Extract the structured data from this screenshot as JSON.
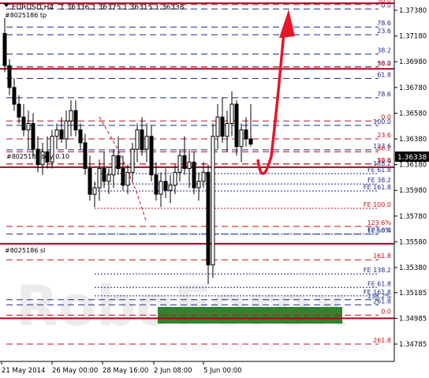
{
  "header": {
    "symbol": "EURUSD,H4",
    "ohlc": "1.36336 1.36375 1.36315 1.36338",
    "label_tp": "#8025186 tp",
    "label_buy": "#8025186 buy 0.10",
    "label_sl": "#8025186 sl"
  },
  "current_price": "1.36338",
  "watermark": "RoboForex",
  "watermark_sub": "ИНТЕРНЕТ-БРОКЕР  ·  ДЛЯ НАЧИНАЮЩИХ  ·  ПРОФЕССИОНАЛОВ",
  "colors": {
    "bull_candle": "#000000",
    "bear_candle": "#000000",
    "trade_line": "#b00020",
    "fibo_blue": "#1a2a8c",
    "fibo_red": "#c0101a",
    "arrow": "#e8142a",
    "target_zone": "#1e7a1e",
    "text": "#000000"
  },
  "chart_data": {
    "type": "candlestick",
    "ylim": [
      1.3465,
      1.3746
    ],
    "y_ticks": [
      "1.37380",
      "1.37180",
      "1.36980",
      "1.36780",
      "1.36580",
      "1.36380",
      "1.36180",
      "1.35980",
      "1.35780",
      "1.35580",
      "1.35380",
      "1.35185",
      "1.34985",
      "1.34785"
    ],
    "x_ticks": [
      "21 May 2014",
      "26 May 00:00",
      "28 May 16:00",
      "2 Jun 08:00",
      "5 Jun 00:00"
    ],
    "trade_levels": [
      {
        "name": "tp",
        "price": 1.37435
      },
      {
        "name": "entry",
        "price": 1.36925
      },
      {
        "name": "buy",
        "price": 1.3616
      },
      {
        "name": "sl",
        "price": 1.35565
      },
      {
        "name": "low",
        "price": 1.34985
      }
    ],
    "fibo_levels": [
      {
        "label": "50.0",
        "price": 1.37425,
        "color": "red"
      },
      {
        "label": "0.0",
        "price": 1.3739,
        "color": "blue"
      },
      {
        "label": "78.6",
        "price": 1.3725,
        "color": "blue"
      },
      {
        "label": "23.6",
        "price": 1.3719,
        "color": "blue"
      },
      {
        "label": "38.2",
        "price": 1.3704,
        "color": "blue"
      },
      {
        "label": "50.0",
        "price": 1.3694,
        "color": "blue"
      },
      {
        "label": "38.2",
        "price": 1.3694,
        "color": "red"
      },
      {
        "label": "61.8",
        "price": 1.3685,
        "color": "blue"
      },
      {
        "label": "78.6",
        "price": 1.367,
        "color": "blue"
      },
      {
        "label": "0.0",
        "price": 1.3652,
        "color": "red"
      },
      {
        "label": "100.0",
        "price": 1.36485,
        "color": "blue"
      },
      {
        "label": "23.6",
        "price": 1.3638,
        "color": "red"
      },
      {
        "label": "123.6",
        "price": 1.36295,
        "color": "blue"
      },
      {
        "label": "38.2",
        "price": 1.3628,
        "color": "red"
      },
      {
        "label": "23.6",
        "price": 1.36185,
        "color": "red"
      },
      {
        "label": "50.0",
        "price": 1.36185,
        "color": "red"
      },
      {
        "label": "138.2",
        "price": 1.3616,
        "color": "blue"
      },
      {
        "label": "FE 61.8",
        "price": 1.3611,
        "color": "blue"
      },
      {
        "label": "FE 38.2",
        "price": 1.3603,
        "color": "blue"
      },
      {
        "label": "FE 161.8",
        "price": 1.35975,
        "color": "blue"
      },
      {
        "label": "FE 100.0",
        "price": 1.3584,
        "color": "red"
      },
      {
        "label": "123.6%",
        "price": 1.357,
        "color": "red"
      },
      {
        "label": "FE 50.0",
        "price": 1.3564,
        "color": "blue"
      },
      {
        "label": "123.6%",
        "price": 1.3564,
        "color": "blue"
      },
      {
        "label": "161.8",
        "price": 1.3544,
        "color": "red"
      },
      {
        "label": "FE 138.2",
        "price": 1.3533,
        "color": "blue"
      },
      {
        "label": "FE 61.8",
        "price": 1.35225,
        "color": "blue"
      },
      {
        "label": "FE 161.8",
        "price": 1.3516,
        "color": "blue"
      },
      {
        "label": "138.2%",
        "price": 1.3513,
        "color": "blue"
      },
      {
        "label": "261.8",
        "price": 1.3509,
        "color": "blue"
      },
      {
        "label": "0.0",
        "price": 1.3501,
        "color": "red"
      },
      {
        "label": "261.8",
        "price": 1.34785,
        "color": "red"
      }
    ],
    "candles": [
      {
        "o": 1.372,
        "h": 1.3732,
        "l": 1.369,
        "c": 1.3695
      },
      {
        "o": 1.3695,
        "h": 1.37,
        "l": 1.3672,
        "c": 1.3678
      },
      {
        "o": 1.3678,
        "h": 1.3685,
        "l": 1.366,
        "c": 1.3665
      },
      {
        "o": 1.3665,
        "h": 1.3672,
        "l": 1.365,
        "c": 1.3655
      },
      {
        "o": 1.3655,
        "h": 1.3665,
        "l": 1.364,
        "c": 1.3645
      },
      {
        "o": 1.3645,
        "h": 1.366,
        "l": 1.363,
        "c": 1.365
      },
      {
        "o": 1.365,
        "h": 1.3658,
        "l": 1.3625,
        "c": 1.363
      },
      {
        "o": 1.363,
        "h": 1.364,
        "l": 1.3612,
        "c": 1.3618
      },
      {
        "o": 1.3618,
        "h": 1.3635,
        "l": 1.361,
        "c": 1.3628
      },
      {
        "o": 1.3628,
        "h": 1.364,
        "l": 1.3615,
        "c": 1.362
      },
      {
        "o": 1.362,
        "h": 1.3645,
        "l": 1.3615,
        "c": 1.364
      },
      {
        "o": 1.364,
        "h": 1.365,
        "l": 1.363,
        "c": 1.3645
      },
      {
        "o": 1.3645,
        "h": 1.3655,
        "l": 1.3635,
        "c": 1.3638
      },
      {
        "o": 1.3638,
        "h": 1.366,
        "l": 1.363,
        "c": 1.3652
      },
      {
        "o": 1.3652,
        "h": 1.3668,
        "l": 1.364,
        "c": 1.366
      },
      {
        "o": 1.366,
        "h": 1.3668,
        "l": 1.364,
        "c": 1.3645
      },
      {
        "o": 1.3645,
        "h": 1.365,
        "l": 1.363,
        "c": 1.3635
      },
      {
        "o": 1.3635,
        "h": 1.3642,
        "l": 1.361,
        "c": 1.3615
      },
      {
        "o": 1.3615,
        "h": 1.3625,
        "l": 1.359,
        "c": 1.3595
      },
      {
        "o": 1.3595,
        "h": 1.3605,
        "l": 1.3585,
        "c": 1.36
      },
      {
        "o": 1.36,
        "h": 1.3622,
        "l": 1.359,
        "c": 1.3615
      },
      {
        "o": 1.3615,
        "h": 1.3628,
        "l": 1.36,
        "c": 1.3605
      },
      {
        "o": 1.3605,
        "h": 1.3615,
        "l": 1.3595,
        "c": 1.361
      },
      {
        "o": 1.361,
        "h": 1.363,
        "l": 1.36,
        "c": 1.3625
      },
      {
        "o": 1.3625,
        "h": 1.364,
        "l": 1.361,
        "c": 1.3615
      },
      {
        "o": 1.3615,
        "h": 1.3625,
        "l": 1.3598,
        "c": 1.3602
      },
      {
        "o": 1.3602,
        "h": 1.3618,
        "l": 1.3595,
        "c": 1.3612
      },
      {
        "o": 1.3612,
        "h": 1.3635,
        "l": 1.3605,
        "c": 1.363
      },
      {
        "o": 1.363,
        "h": 1.365,
        "l": 1.362,
        "c": 1.3645
      },
      {
        "o": 1.3645,
        "h": 1.3655,
        "l": 1.3625,
        "c": 1.363
      },
      {
        "o": 1.363,
        "h": 1.365,
        "l": 1.362,
        "c": 1.364
      },
      {
        "o": 1.364,
        "h": 1.3648,
        "l": 1.3605,
        "c": 1.361
      },
      {
        "o": 1.361,
        "h": 1.362,
        "l": 1.359,
        "c": 1.3595
      },
      {
        "o": 1.3595,
        "h": 1.3612,
        "l": 1.3585,
        "c": 1.3605
      },
      {
        "o": 1.3605,
        "h": 1.3615,
        "l": 1.3592,
        "c": 1.3598
      },
      {
        "o": 1.3598,
        "h": 1.361,
        "l": 1.3588,
        "c": 1.3602
      },
      {
        "o": 1.3602,
        "h": 1.3618,
        "l": 1.3595,
        "c": 1.3612
      },
      {
        "o": 1.3612,
        "h": 1.363,
        "l": 1.3605,
        "c": 1.3625
      },
      {
        "o": 1.3625,
        "h": 1.364,
        "l": 1.361,
        "c": 1.3615
      },
      {
        "o": 1.3615,
        "h": 1.363,
        "l": 1.36,
        "c": 1.362
      },
      {
        "o": 1.362,
        "h": 1.3628,
        "l": 1.3595,
        "c": 1.36
      },
      {
        "o": 1.36,
        "h": 1.3612,
        "l": 1.359,
        "c": 1.3605
      },
      {
        "o": 1.3605,
        "h": 1.362,
        "l": 1.36,
        "c": 1.3612
      },
      {
        "o": 1.3612,
        "h": 1.3618,
        "l": 1.3525,
        "c": 1.354
      },
      {
        "o": 1.354,
        "h": 1.365,
        "l": 1.353,
        "c": 1.364
      },
      {
        "o": 1.364,
        "h": 1.3665,
        "l": 1.363,
        "c": 1.3655
      },
      {
        "o": 1.3655,
        "h": 1.367,
        "l": 1.3635,
        "c": 1.364
      },
      {
        "o": 1.364,
        "h": 1.366,
        "l": 1.3628,
        "c": 1.365
      },
      {
        "o": 1.365,
        "h": 1.3675,
        "l": 1.364,
        "c": 1.3665
      },
      {
        "o": 1.3665,
        "h": 1.3668,
        "l": 1.3625,
        "c": 1.3632
      },
      {
        "o": 1.3632,
        "h": 1.365,
        "l": 1.362,
        "c": 1.3645
      },
      {
        "o": 1.3645,
        "h": 1.3655,
        "l": 1.3632,
        "c": 1.3638
      },
      {
        "o": 1.3638,
        "h": 1.3665,
        "l": 1.3632,
        "c": 1.3634
      }
    ]
  }
}
